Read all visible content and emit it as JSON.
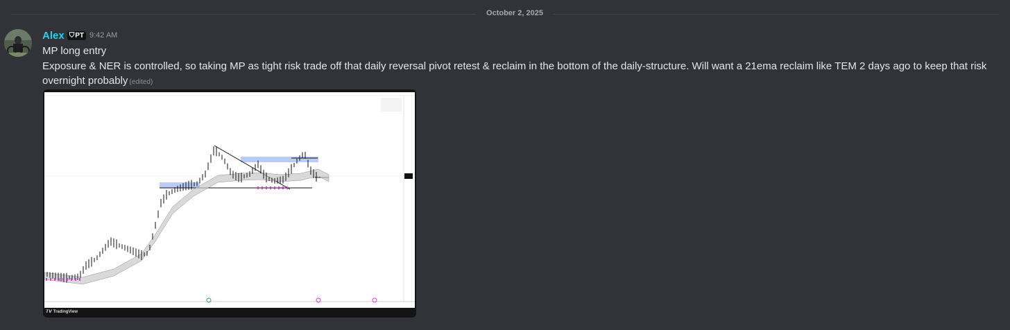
{
  "date_divider": "October 2, 2025",
  "message": {
    "username": "Alex",
    "tag": "PT",
    "timestamp": "9:42 AM",
    "line1": "MP long entry",
    "line2": "Exposure & NER is controlled, so taking MP as tight risk trade off that daily reversal pivot retest & reclaim in the bottom of the daily-structure. Will want a 21ema reclaim like TEM 2 days ago to keep that risk",
    "line3": "overnight probably",
    "edited": "(edited)"
  },
  "embed": {
    "footer": "TradingView"
  },
  "colors": {
    "background": "#323339",
    "username": "#22d3ee",
    "chart_bars": "#111111",
    "zone_fill": "#b8ccf7",
    "magenta_markers": "#d63ad8",
    "ema_band": "#c9c9c9"
  }
}
